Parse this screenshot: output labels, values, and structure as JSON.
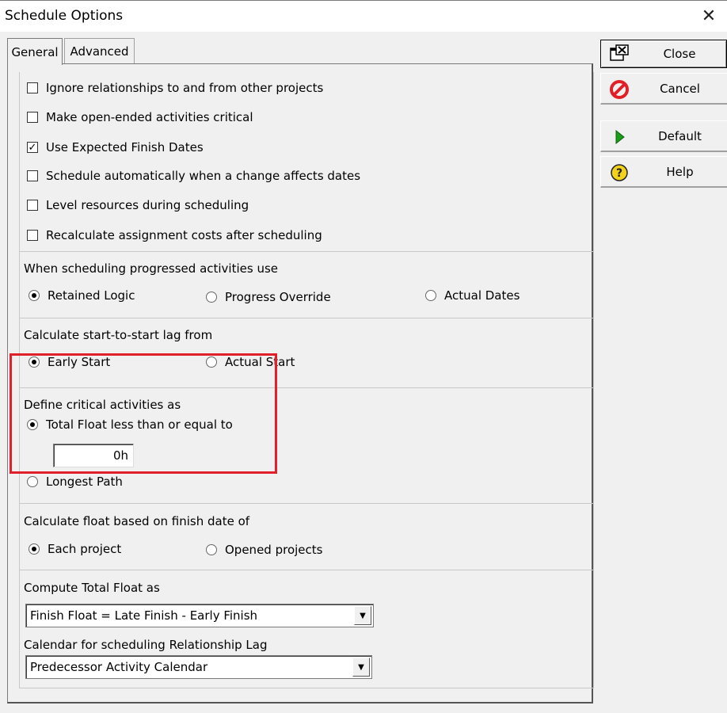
{
  "window": {
    "title": "Schedule Options",
    "close_glyph": "✕"
  },
  "tabs": [
    {
      "label": "General",
      "active": true
    },
    {
      "label": "Advanced",
      "active": false
    }
  ],
  "checkboxes": [
    {
      "label": "Ignore relationships to and from other projects",
      "checked": false
    },
    {
      "label": "Make open-ended activities critical",
      "checked": false
    },
    {
      "label": "Use Expected Finish Dates",
      "checked": true
    },
    {
      "label": "Schedule automatically when a change affects dates",
      "checked": false
    },
    {
      "label": "Level resources during scheduling",
      "checked": false
    },
    {
      "label": "Recalculate assignment costs after scheduling",
      "checked": false
    }
  ],
  "progressed": {
    "heading": "When scheduling progressed activities use",
    "options": [
      "Retained Logic",
      "Progress Override",
      "Actual Dates"
    ],
    "selected": 0
  },
  "sslag": {
    "heading": "Calculate start-to-start lag from",
    "options": [
      "Early Start",
      "Actual Start"
    ],
    "selected": 0
  },
  "critical": {
    "heading": "Define critical activities as",
    "options": [
      "Total Float less than or equal to",
      "Longest Path"
    ],
    "selected": 0,
    "float_value": "0h"
  },
  "floatbasis": {
    "heading": "Calculate float based on finish date of",
    "options": [
      "Each project",
      "Opened projects"
    ],
    "selected": 0
  },
  "totalfloat": {
    "heading": "Compute Total Float as",
    "value": "Finish Float = Late Finish - Early Finish"
  },
  "lagcal": {
    "heading": "Calendar for scheduling Relationship Lag",
    "value": "Predecessor Activity Calendar"
  },
  "buttons": {
    "close": "Close",
    "cancel": "Cancel",
    "default": "Default",
    "help": "Help"
  },
  "colors": {
    "highlight": "#e0202a",
    "cancel_icon": "#e01f26",
    "default_icon": "#1a9e1a",
    "help_icon": "#f2d21b"
  }
}
